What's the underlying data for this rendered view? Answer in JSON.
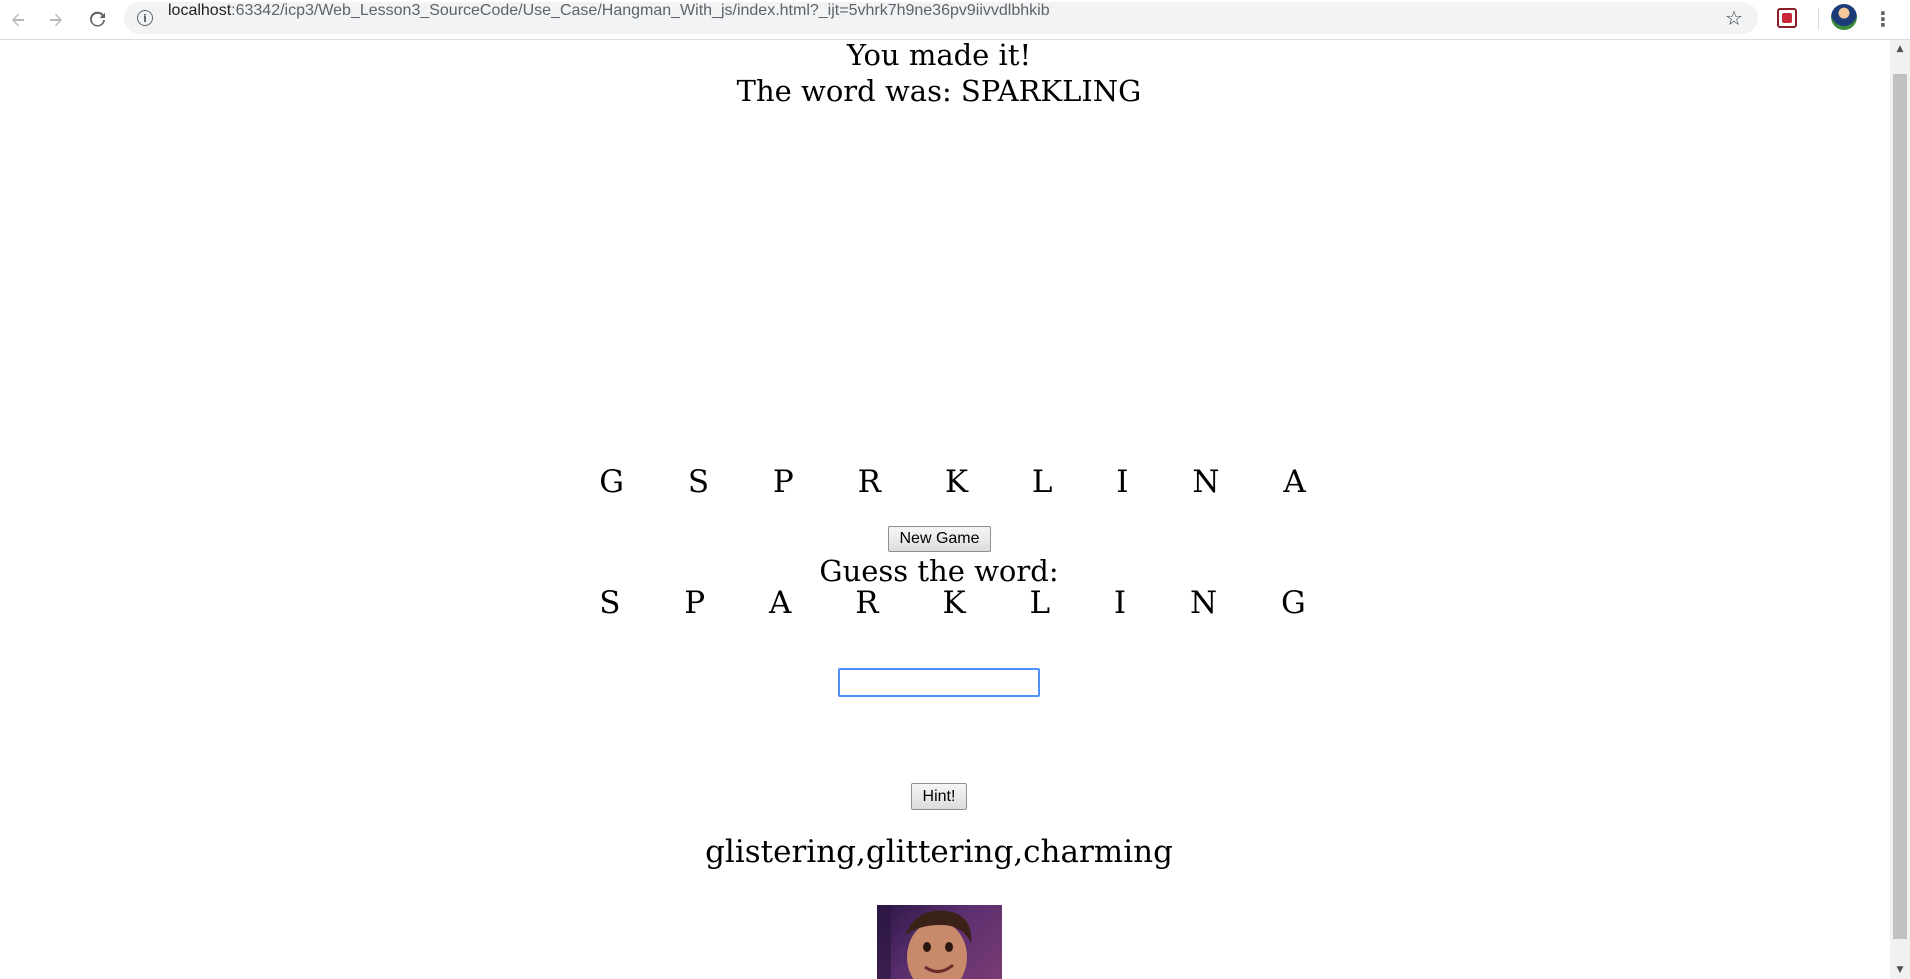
{
  "browser": {
    "url_host": "localhost",
    "url_rest": ":63342/icp3/Web_Lesson3_SourceCode/Use_Case/Hangman_With_js/index.html?_ijt=5vhrk7h9ne36pv9iivvdlbhkib"
  },
  "game": {
    "status_title": "You made it!",
    "status_message": "The word was: SPARKLING",
    "guessed_letters": "G S P R K L I N A",
    "new_game_label": "New Game",
    "prompt": "Guess the word:",
    "word_display": "S P A R K L I N G",
    "guess_input_value": "",
    "hint_label": "Hint!",
    "hint_text": "glistering,glittering,charming"
  }
}
